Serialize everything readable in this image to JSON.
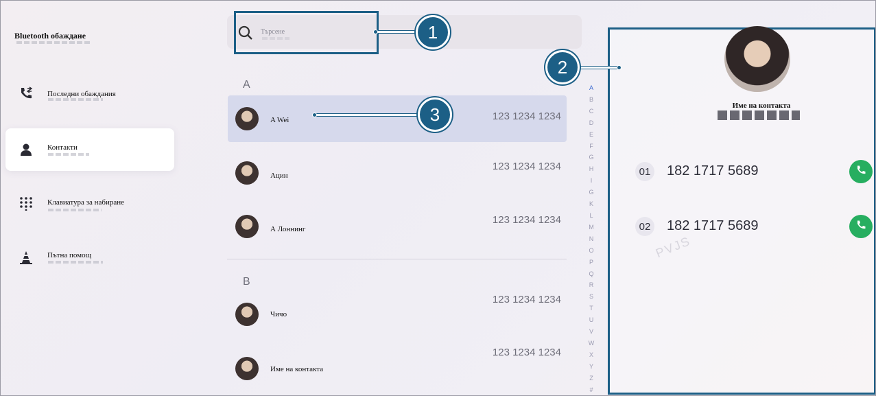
{
  "sidebar": {
    "title": "Bluetooth обаждане",
    "items": [
      {
        "label": "Последни обаждания",
        "icon": "recent-calls-icon"
      },
      {
        "label": "Контакти",
        "icon": "contact-person-icon",
        "active": true
      },
      {
        "label": "Клавиатура за набиране",
        "icon": "dialpad-icon"
      },
      {
        "label": "Пътна помощ",
        "icon": "roadside-assistance-icon"
      }
    ]
  },
  "search": {
    "placeholder": "Търсене"
  },
  "contacts": {
    "groups": [
      {
        "letter": "A",
        "rows": [
          {
            "name": "A Wei",
            "phone": "123 1234 1234",
            "selected": true
          },
          {
            "name": "Ацин",
            "phone": "123 1234 1234"
          },
          {
            "name": "А Лоннинг",
            "phone": "123 1234 1234"
          }
        ]
      },
      {
        "letter": "B",
        "rows": [
          {
            "name": "Чичо",
            "phone": "123 1234 1234"
          },
          {
            "name": "Име на контакта",
            "phone": "123 1234 1234"
          }
        ]
      }
    ]
  },
  "alphabet": [
    "A",
    "B",
    "C",
    "D",
    "E",
    "F",
    "G",
    "H",
    "I",
    "G",
    "K",
    "L",
    "M",
    "N",
    "O",
    "P",
    "Q",
    "R",
    "S",
    "T",
    "U",
    "V",
    "W",
    "X",
    "Y",
    "Z",
    "#"
  ],
  "detail": {
    "name": "Име на контакта",
    "numbers": [
      {
        "index": "01",
        "value": "182 1717 5689"
      },
      {
        "index": "02",
        "value": "182 1717 5689"
      }
    ],
    "watermark": "PVJS"
  },
  "callouts": [
    "1",
    "2",
    "3"
  ],
  "colors": {
    "callout": "#1c5f86",
    "call_button": "#27ae60",
    "selected_row": "#d6d9ec"
  }
}
